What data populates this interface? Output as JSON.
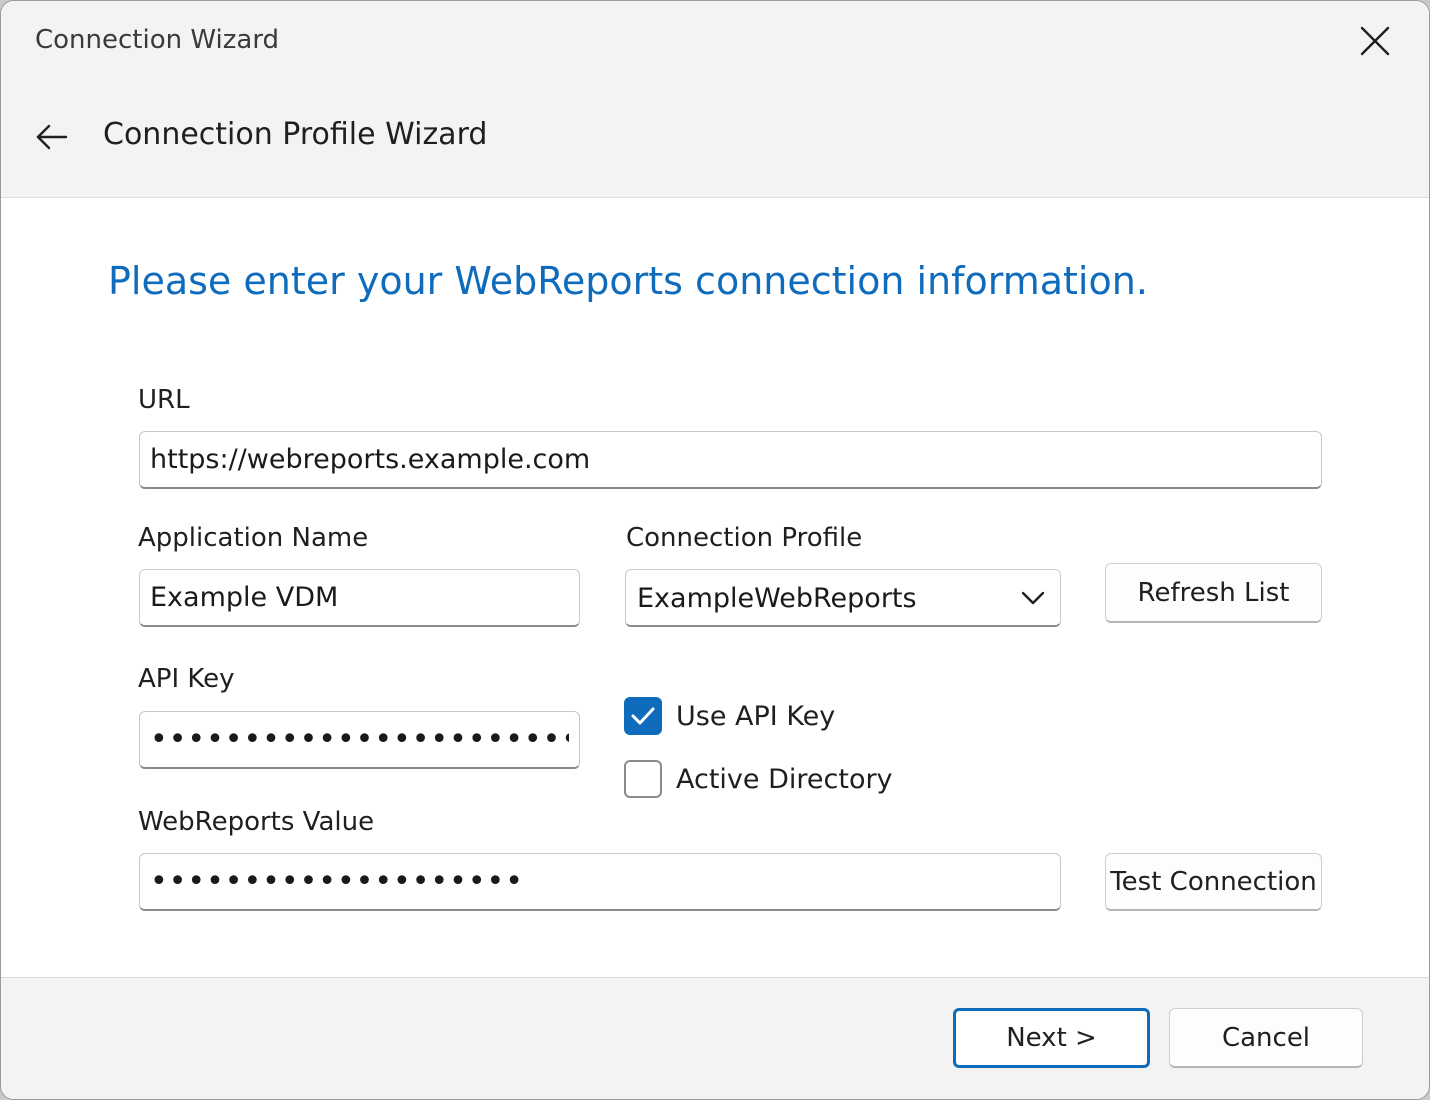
{
  "window": {
    "title": "Connection Wizard"
  },
  "header": {
    "wizard_title": "Connection Profile Wizard"
  },
  "main": {
    "heading": "Please enter your WebReports connection information.",
    "url": {
      "label": "URL",
      "value": "https://webreports.example.com"
    },
    "application_name": {
      "label": "Application Name",
      "value": "Example VDM"
    },
    "connection_profile": {
      "label": "Connection Profile",
      "selected": "ExampleWebReports"
    },
    "refresh_list_label": "Refresh List",
    "api_key": {
      "label": "API Key",
      "value": "•••••••••••••••••••••••"
    },
    "use_api_key": {
      "label": "Use API Key",
      "checked": true
    },
    "active_directory": {
      "label": "Active Directory",
      "checked": false
    },
    "webreports_value": {
      "label": "WebReports Value",
      "value": "••••••••••••••••••••"
    },
    "test_connection_label": "Test Connection"
  },
  "footer": {
    "next_label": "Next >",
    "cancel_label": "Cancel"
  },
  "colors": {
    "accent": "#0f6cbd",
    "chrome_background": "#f3f3f3",
    "content_background": "#ffffff"
  },
  "icons": {
    "close": "close-icon",
    "back": "arrow-left-icon",
    "dropdown": "chevron-down-icon",
    "check": "checkmark-icon"
  }
}
